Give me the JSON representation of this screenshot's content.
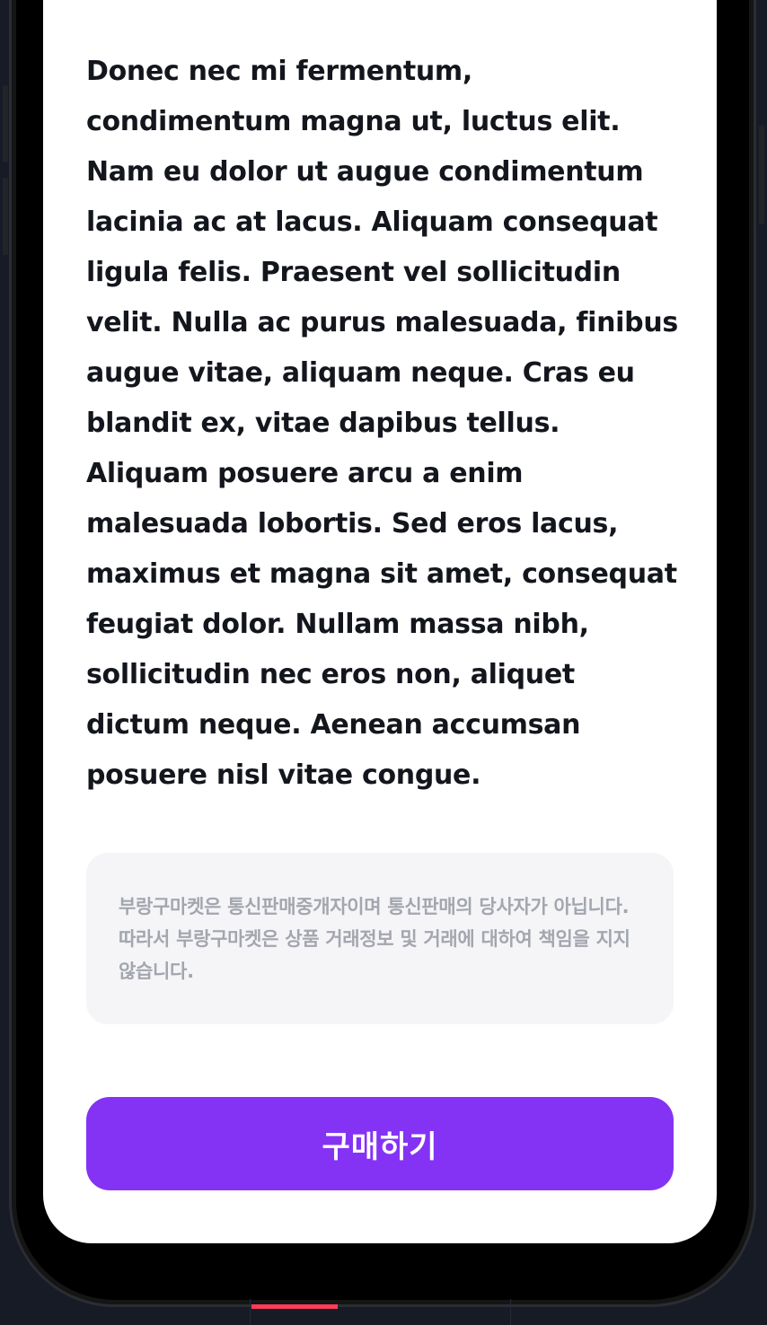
{
  "product": {
    "description": "Donec nec mi fermentum, condimentum magna ut, luctus elit. Nam eu dolor ut augue condimentum lacinia ac at lacus. Aliquam consequat ligula felis. Praesent vel sollicitudin velit. Nulla ac purus malesuada, finibus augue vitae, aliquam neque. Cras eu blandit ex, vitae dapibus tellus. Aliquam posuere arcu a enim malesuada lobortis. Sed eros lacus, maximus et magna sit amet, consequat feugiat dolor. Nullam massa nibh, sollicitudin nec eros non, aliquet dictum neque. Aenean accumsan posuere nisl vitae congue."
  },
  "notice": {
    "text": "부랑구마켓은 통신판매중개자이며 통신판매의 당사자가 아닙니다. 따라서 부랑구마켓은 상품 거래정보 및 거래에 대하여 책임을 지지 않습니다."
  },
  "actions": {
    "buy_label": "구매하기"
  },
  "colors": {
    "accent": "#8433f5",
    "active_tab": "#ff3d5a",
    "background": "#171b26"
  }
}
